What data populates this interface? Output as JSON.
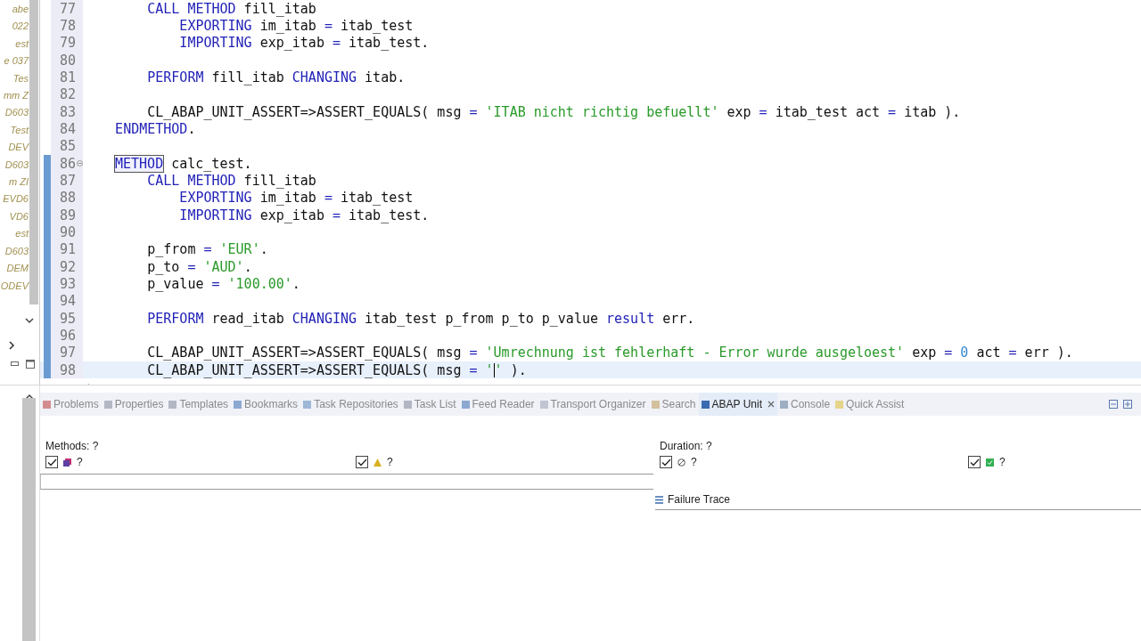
{
  "sidebar": {
    "items": [
      "abe",
      "022",
      "est",
      "e 037",
      "Tes",
      "mm Z",
      "D603",
      "Test",
      "DEV",
      "D603",
      "m ZI",
      "EVD6",
      "VD6",
      "est",
      "D603",
      "DEM",
      "ODEV"
    ]
  },
  "editor": {
    "lines": [
      {
        "number": "77",
        "changed": false,
        "current": false,
        "tokens": [
          {
            "kind": "kw",
            "text": "        CALL METHOD"
          },
          {
            "kind": "plain",
            "text": " fill_itab"
          }
        ]
      },
      {
        "number": "78",
        "changed": false,
        "current": false,
        "tokens": [
          {
            "kind": "kw",
            "text": "            EXPORTING"
          },
          {
            "kind": "plain",
            "text": " im_itab "
          },
          {
            "kind": "kw",
            "text": "="
          },
          {
            "kind": "plain",
            "text": " itab_test"
          }
        ]
      },
      {
        "number": "79",
        "changed": false,
        "current": false,
        "tokens": [
          {
            "kind": "kw",
            "text": "            IMPORTING"
          },
          {
            "kind": "plain",
            "text": " exp_itab "
          },
          {
            "kind": "kw",
            "text": "="
          },
          {
            "kind": "plain",
            "text": " itab_test."
          }
        ]
      },
      {
        "number": "80",
        "changed": false,
        "current": false
      },
      {
        "number": "81",
        "changed": false,
        "current": false,
        "tokens": [
          {
            "kind": "kw",
            "text": "        PERFORM"
          },
          {
            "kind": "plain",
            "text": " fill_itab "
          },
          {
            "kind": "kw",
            "text": "CHANGING"
          },
          {
            "kind": "plain",
            "text": " itab."
          }
        ]
      },
      {
        "number": "82",
        "changed": false,
        "current": false
      },
      {
        "number": "83",
        "changed": false,
        "current": false,
        "tokens": [
          {
            "kind": "plain",
            "text": "        CL_ABAP_UNIT_ASSERT=>ASSERT_EQUALS( msg "
          },
          {
            "kind": "kw",
            "text": "="
          },
          {
            "kind": "str",
            "text": " 'ITAB nicht richtig befuellt'"
          },
          {
            "kind": "plain",
            "text": " exp "
          },
          {
            "kind": "kw",
            "text": "="
          },
          {
            "kind": "plain",
            "text": " itab_test act "
          },
          {
            "kind": "kw",
            "text": "="
          },
          {
            "kind": "plain",
            "text": " itab )."
          }
        ]
      },
      {
        "number": "84",
        "changed": false,
        "current": false,
        "tokens": [
          {
            "kind": "kw",
            "text": "    ENDMETHOD"
          },
          {
            "kind": "plain",
            "text": "."
          }
        ]
      },
      {
        "number": "85",
        "changed": false,
        "current": false
      },
      {
        "number": "86",
        "changed": true,
        "current": false,
        "fold": true,
        "tokens": [
          {
            "kind": "kwbox",
            "text": "METHOD"
          },
          {
            "kind": "plain",
            "text": " calc_test."
          }
        ]
      },
      {
        "number": "87",
        "changed": true,
        "current": false,
        "tokens": [
          {
            "kind": "kw",
            "text": "        CALL METHOD"
          },
          {
            "kind": "plain",
            "text": " fill_itab"
          }
        ]
      },
      {
        "number": "88",
        "changed": true,
        "current": false,
        "tokens": [
          {
            "kind": "kw",
            "text": "            EXPORTING"
          },
          {
            "kind": "plain",
            "text": " im_itab "
          },
          {
            "kind": "kw",
            "text": "="
          },
          {
            "kind": "plain",
            "text": " itab_test"
          }
        ]
      },
      {
        "number": "89",
        "changed": true,
        "current": false,
        "tokens": [
          {
            "kind": "kw",
            "text": "            IMPORTING"
          },
          {
            "kind": "plain",
            "text": " exp_itab "
          },
          {
            "kind": "kw",
            "text": "="
          },
          {
            "kind": "plain",
            "text": " itab_test."
          }
        ]
      },
      {
        "number": "90",
        "changed": true,
        "current": false
      },
      {
        "number": "91",
        "changed": true,
        "current": false,
        "tokens": [
          {
            "kind": "plain",
            "text": "        p_from "
          },
          {
            "kind": "kw",
            "text": "="
          },
          {
            "kind": "str",
            "text": " 'EUR'"
          },
          {
            "kind": "plain",
            "text": "."
          }
        ]
      },
      {
        "number": "92",
        "changed": true,
        "current": false,
        "tokens": [
          {
            "kind": "plain",
            "text": "        p_to "
          },
          {
            "kind": "kw",
            "text": "="
          },
          {
            "kind": "str",
            "text": " 'AUD'"
          },
          {
            "kind": "plain",
            "text": "."
          }
        ]
      },
      {
        "number": "93",
        "changed": true,
        "current": false,
        "tokens": [
          {
            "kind": "plain",
            "text": "        p_value "
          },
          {
            "kind": "kw",
            "text": "="
          },
          {
            "kind": "str",
            "text": " '100.00'"
          },
          {
            "kind": "plain",
            "text": "."
          }
        ]
      },
      {
        "number": "94",
        "changed": true,
        "current": false
      },
      {
        "number": "95",
        "changed": true,
        "current": false,
        "tokens": [
          {
            "kind": "kw",
            "text": "        PERFORM"
          },
          {
            "kind": "plain",
            "text": " read_itab "
          },
          {
            "kind": "kw",
            "text": "CHANGING"
          },
          {
            "kind": "plain",
            "text": " itab_test p_from p_to p_value "
          },
          {
            "kind": "kw",
            "text": "result"
          },
          {
            "kind": "plain",
            "text": " err."
          }
        ]
      },
      {
        "number": "96",
        "changed": true,
        "current": false
      },
      {
        "number": "97",
        "changed": true,
        "current": false,
        "tokens": [
          {
            "kind": "plain",
            "text": "        CL_ABAP_UNIT_ASSERT=>ASSERT_EQUALS( msg "
          },
          {
            "kind": "kw",
            "text": "="
          },
          {
            "kind": "str",
            "text": " 'Umrechnung ist fehlerhaft - Error wurde ausgeloest'"
          },
          {
            "kind": "plain",
            "text": " exp "
          },
          {
            "kind": "kw",
            "text": "="
          },
          {
            "kind": "num",
            "text": " 0"
          },
          {
            "kind": "plain",
            "text": " act "
          },
          {
            "kind": "kw",
            "text": "="
          },
          {
            "kind": "plain",
            "text": " err )."
          }
        ]
      },
      {
        "number": "98",
        "changed": true,
        "current": true,
        "tokens": [
          {
            "kind": "plain",
            "text": "        CL_ABAP_UNIT_ASSERT=>ASSERT_EQUALS( msg "
          },
          {
            "kind": "kw",
            "text": "="
          },
          {
            "kind": "str",
            "text": " '",
            "caret_after": true
          },
          {
            "kind": "str",
            "text": "'"
          },
          {
            "kind": "plain",
            "text": " )."
          }
        ]
      }
    ]
  },
  "bottom_panel": {
    "tabs": [
      {
        "label": "Problems",
        "selected": false,
        "closable": false
      },
      {
        "label": "Properties",
        "selected": false,
        "closable": false
      },
      {
        "label": "Templates",
        "selected": false,
        "closable": false
      },
      {
        "label": "Bookmarks",
        "selected": false,
        "closable": false
      },
      {
        "label": "Task Repositories",
        "selected": false,
        "closable": false
      },
      {
        "label": "Task List",
        "selected": false,
        "closable": false
      },
      {
        "label": "Feed Reader",
        "selected": false,
        "closable": false
      },
      {
        "label": "Transport Organizer",
        "selected": false,
        "closable": false
      },
      {
        "label": "Search",
        "selected": false,
        "closable": false
      },
      {
        "label": "ABAP Unit",
        "selected": true,
        "closable": true
      },
      {
        "label": "Console",
        "selected": false,
        "closable": false
      },
      {
        "label": "Quick Assist",
        "selected": false,
        "closable": false
      }
    ],
    "methods_label": "Methods: ?",
    "duration_label": "Duration: ?",
    "filters": [
      {
        "kind": "error",
        "checked": true,
        "count": "?"
      },
      {
        "kind": "warning",
        "checked": true,
        "count": "?"
      },
      {
        "kind": "skipped",
        "checked": true,
        "count": "?"
      },
      {
        "kind": "success",
        "checked": true,
        "count": "?"
      }
    ],
    "failure_trace_title": "Failure Trace"
  }
}
